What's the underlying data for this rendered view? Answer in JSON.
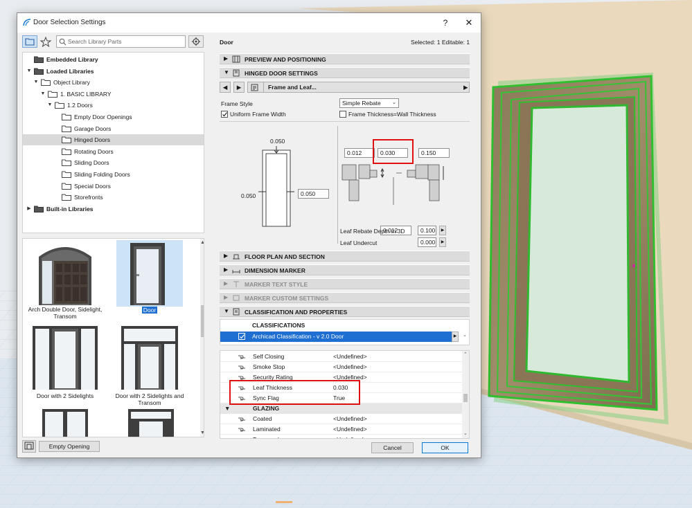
{
  "dialog": {
    "title": "Door Selection Settings",
    "help": "?",
    "close": "✕"
  },
  "left": {
    "search_placeholder": "Search Library Parts",
    "tree": [
      {
        "label": "Embedded Library",
        "bold": true
      },
      {
        "label": "Loaded Libraries",
        "bold": true
      },
      {
        "label": "Object Library"
      },
      {
        "label": "1. BASIC LIBRARY"
      },
      {
        "label": "1.2 Doors"
      },
      {
        "label": "Empty Door Openings"
      },
      {
        "label": "Garage Doors"
      },
      {
        "label": "Hinged Doors",
        "selected": true
      },
      {
        "label": "Rotating Doors"
      },
      {
        "label": "Sliding Doors"
      },
      {
        "label": "Sliding Folding Doors"
      },
      {
        "label": "Special Doors"
      },
      {
        "label": "Storefronts"
      },
      {
        "label": "Built-in Libraries",
        "bold": true
      }
    ],
    "gallery": [
      {
        "caption": "Arch Double Door, Sidelight, Transom"
      },
      {
        "caption": "Door",
        "selected": true
      },
      {
        "caption": "Door with 2 Sidelights"
      },
      {
        "caption": "Door with 2 Sidelights and Transom"
      }
    ],
    "empty_opening": "Empty Opening"
  },
  "right": {
    "header": "Door",
    "selection_info": "Selected: 1 Editable: 1",
    "sections": {
      "preview": "PREVIEW AND POSITIONING",
      "hinged": "HINGED DOOR SETTINGS",
      "floorplan": "FLOOR PLAN AND SECTION",
      "dimension": "DIMENSION MARKER",
      "marker_text": "MARKER TEXT STYLE",
      "marker_custom": "MARKER CUSTOM SETTINGS",
      "classification": "CLASSIFICATION AND PROPERTIES"
    },
    "page_select": "Frame and Leaf...",
    "frame_style_label": "Frame Style",
    "frame_style_value": "Simple Rebate",
    "uniform_frame": "Uniform Frame Width",
    "frame_thickness": "Frame Thickness=Wall Thickness",
    "dims": {
      "top": "0.050",
      "left": "0.050",
      "side": "0.050",
      "d1": "0.012",
      "d2": "0.030",
      "d3": "0.150",
      "d4": "0.012"
    },
    "leaf_rebate_label": "Leaf Rebate Depth in 3D",
    "leaf_rebate_value": "0.100",
    "leaf_undercut_label": "Leaf Undercut",
    "leaf_undercut_value": "0.000",
    "classifications_header": "CLASSIFICATIONS",
    "classification_item": "Archicad Classification - v 2.0 Door",
    "properties": [
      {
        "name": "Self Closing",
        "value": "<Undefined>"
      },
      {
        "name": "Smoke Stop",
        "value": "<Undefined>"
      },
      {
        "name": "Security Rating",
        "value": "<Undefined>"
      },
      {
        "name": "Leaf Thickness",
        "value": "0.030"
      },
      {
        "name": "Sync Flag",
        "value": "True"
      }
    ],
    "glazing_header": "GLAZING",
    "glazing": [
      {
        "name": "Coated",
        "value": "<Undefined>"
      },
      {
        "name": "Laminated",
        "value": "<Undefined>"
      },
      {
        "name": "Tempered",
        "value": "<Undefined>"
      }
    ],
    "cancel": "Cancel",
    "ok": "OK"
  }
}
